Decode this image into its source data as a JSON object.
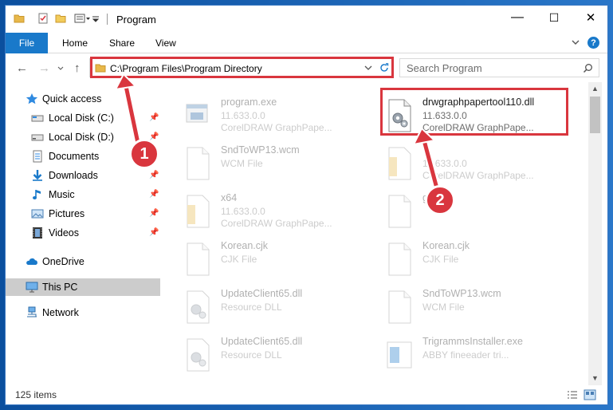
{
  "window": {
    "title": "Program",
    "controls": {
      "minimize": "—",
      "maximize": "☐",
      "close": "✕"
    }
  },
  "ribbon": {
    "file": "File",
    "tabs": [
      "Home",
      "Share",
      "View"
    ],
    "help": "?"
  },
  "address": {
    "path": "C:\\Program Files\\Program Directory",
    "search_placeholder": "Search Program"
  },
  "sidebar": {
    "items": [
      {
        "label": "Quick access",
        "icon": "star-icon"
      },
      {
        "label": "Local Disk (C:)",
        "icon": "drive-icon",
        "pinned": true
      },
      {
        "label": "Local Disk (D:)",
        "icon": "drive-icon",
        "pinned": true
      },
      {
        "label": "Documents",
        "icon": "documents-icon",
        "pinned": true
      },
      {
        "label": "Downloads",
        "icon": "downloads-icon",
        "pinned": true
      },
      {
        "label": "Music",
        "icon": "music-icon",
        "pinned": true
      },
      {
        "label": "Pictures",
        "icon": "pictures-icon",
        "pinned": true
      },
      {
        "label": "Videos",
        "icon": "videos-icon",
        "pinned": true
      },
      {
        "label": "OneDrive",
        "icon": "onedrive-icon"
      },
      {
        "label": "This PC",
        "icon": "pc-icon",
        "selected": true
      },
      {
        "label": "Network",
        "icon": "network-icon"
      }
    ]
  },
  "files": [
    {
      "name": "program.exe",
      "line1": "11.633.0.0",
      "line2": "CorelDRAW GraphPape...",
      "icon": "exe-icon",
      "faded": true
    },
    {
      "name": "drwgraphpapertool110.dll",
      "line1": "11.633.0.0",
      "line2": "CorelDRAW GraphPape...",
      "icon": "dll-gear-icon",
      "faded": false
    },
    {
      "name": "SndToWP13.wcm",
      "line1": "WCM File",
      "line2": "",
      "icon": "blank-file-icon",
      "faded": true
    },
    {
      "name": "",
      "line1": "11.633.0.0",
      "line2": "CorelDRAW GraphPape...",
      "icon": "folder-file-icon",
      "faded": true
    },
    {
      "name": "x64",
      "line1": "11.633.0.0",
      "line2": "CorelDRAW GraphPape...",
      "icon": "folder-file-icon",
      "faded": true
    },
    {
      "name": "gi",
      "line1": "",
      "line2": "",
      "icon": "blank-file-icon",
      "faded": true
    },
    {
      "name": "Korean.cjk",
      "line1": "CJK File",
      "line2": "",
      "icon": "blank-file-icon",
      "faded": true
    },
    {
      "name": "Korean.cjk",
      "line1": "CJK File",
      "line2": "",
      "icon": "blank-file-icon",
      "faded": true
    },
    {
      "name": "UpdateClient65.dll",
      "line1": "Resource DLL",
      "line2": "",
      "icon": "dll-gear-icon",
      "faded": true
    },
    {
      "name": "SndToWP13.wcm",
      "line1": "WCM File",
      "line2": "",
      "icon": "blank-file-icon",
      "faded": true
    },
    {
      "name": "UpdateClient65.dll",
      "line1": "Resource DLL",
      "line2": "",
      "icon": "dll-gear-icon",
      "faded": true
    },
    {
      "name": "TrigrammsInstaller.exe",
      "line1": "ABBY fineeader tri...",
      "line2": "",
      "icon": "installer-icon",
      "faded": true
    }
  ],
  "status": {
    "count": "125 items"
  },
  "callouts": [
    "1",
    "2"
  ],
  "colors": {
    "accent": "#1979ca",
    "highlight": "#d9363e",
    "selected": "#cccccc"
  }
}
